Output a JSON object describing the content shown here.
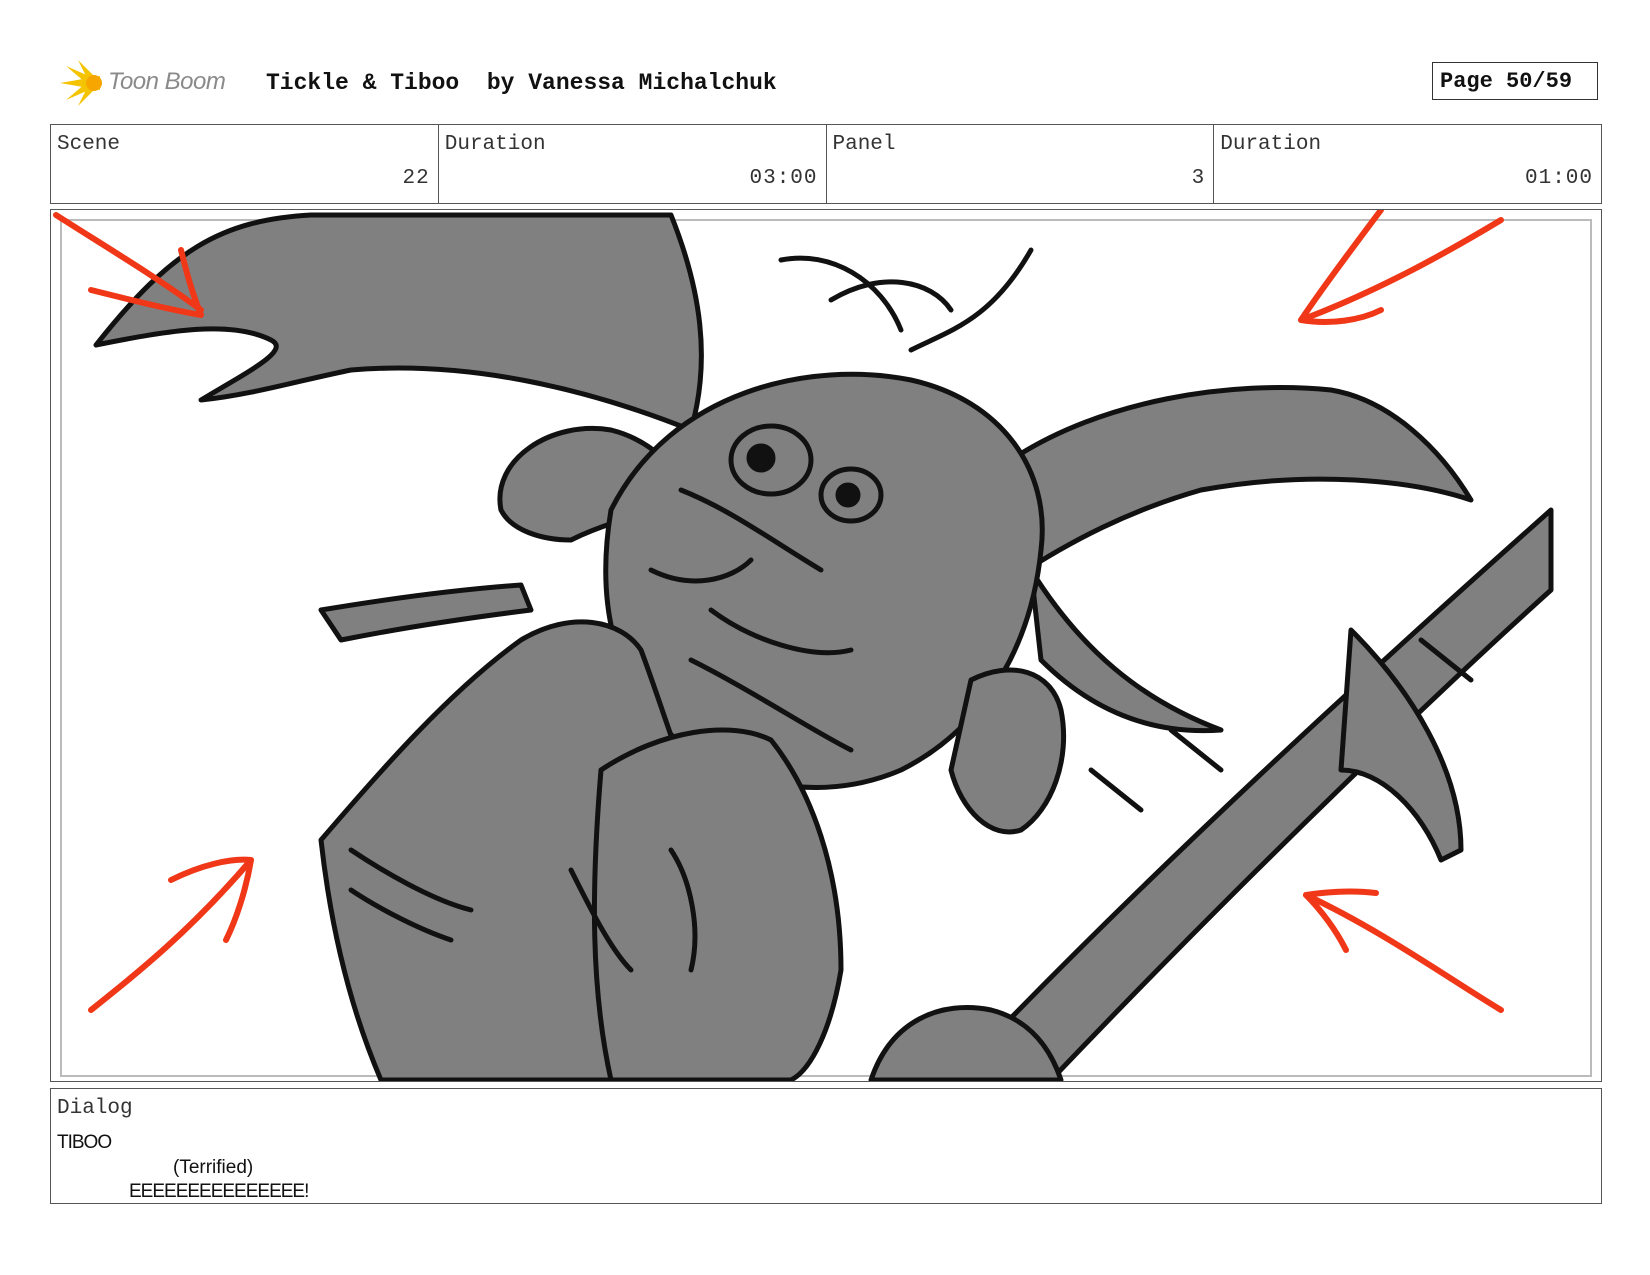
{
  "header": {
    "logo_text": "Toon Boom",
    "title": "Tickle & Tiboo  by Vanessa Michalchuk",
    "page": "Page 50/59"
  },
  "info": [
    {
      "label": "Scene",
      "value": "22"
    },
    {
      "label": "Duration",
      "value": "03:00"
    },
    {
      "label": "Panel",
      "value": "3"
    },
    {
      "label": "Duration",
      "value": "01:00"
    }
  ],
  "dialog": {
    "label": "Dialog",
    "character": "TIBOO",
    "parenthetical": "(Terrified)",
    "line": "EEEEEEEEEEEEEEE!"
  },
  "colors": {
    "arrow_red": "#f03818",
    "sketch_gray": "#808080",
    "logo_yellow": "#f5c400"
  }
}
